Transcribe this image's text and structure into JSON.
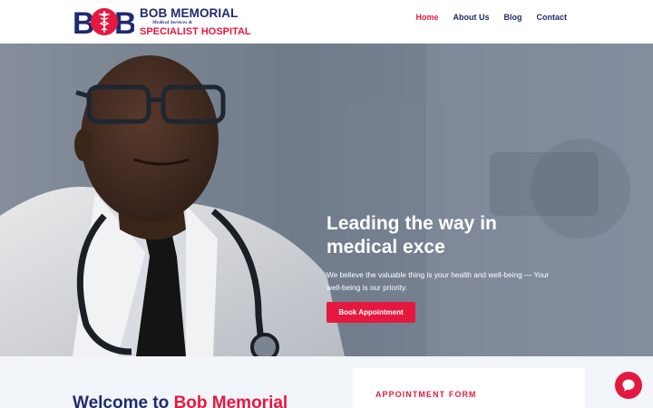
{
  "header": {
    "logo": {
      "mark_text": "BOB",
      "line1": "BOB MEMORIAL",
      "line2": "Medical Services &",
      "line3": "SPECIALIST HOSPITAL"
    },
    "nav": [
      {
        "label": "Home",
        "active": true
      },
      {
        "label": "About Us",
        "active": false
      },
      {
        "label": "Blog",
        "active": false
      },
      {
        "label": "Contact",
        "active": false
      }
    ]
  },
  "hero": {
    "title": "Leading the way in medical exce",
    "text": "We believe the valuable thing is your health and well-being — Your well-being is our priority.",
    "button_label": "Book Appointment"
  },
  "welcome": {
    "prefix": "Welcome to ",
    "accent": "Bob Memorial"
  },
  "appointment_form": {
    "label": "APPOINTMENT FORM"
  },
  "icons": {
    "chat": "chat-bubble-icon",
    "logo_symbol": "caduceus-icon"
  },
  "colors": {
    "brand_navy": "#1f2b6e",
    "brand_red": "#e5193f",
    "section_bg": "#f2f5fa"
  }
}
